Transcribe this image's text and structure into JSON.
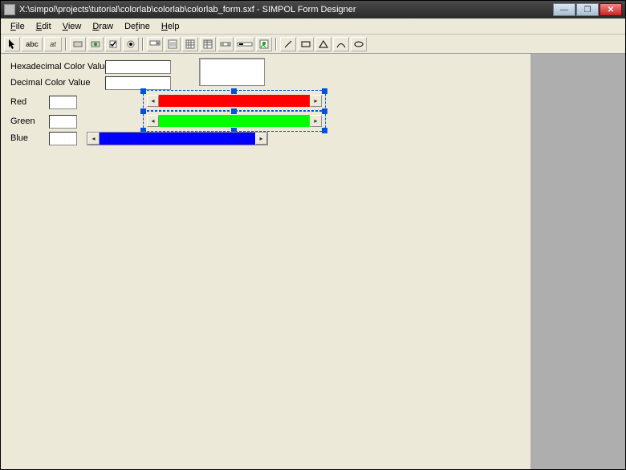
{
  "window": {
    "title": "X:\\simpol\\projects\\tutorial\\colorlab\\colorlab\\colorlab_form.sxf - SIMPOL Form Designer"
  },
  "menu": {
    "file": "File",
    "edit": "Edit",
    "view": "View",
    "draw": "Draw",
    "define": "Define",
    "help": "Help"
  },
  "form": {
    "hex_label": "Hexadecimal Color Value",
    "dec_label": "Decimal Color Value",
    "red_label": "Red",
    "green_label": "Green",
    "blue_label": "Blue",
    "hex_value": "",
    "dec_value": "",
    "red_value": "",
    "green_value": "",
    "blue_value": ""
  },
  "colors": {
    "red": "#ff0000",
    "green": "#00ff00",
    "blue": "#0000ff"
  }
}
